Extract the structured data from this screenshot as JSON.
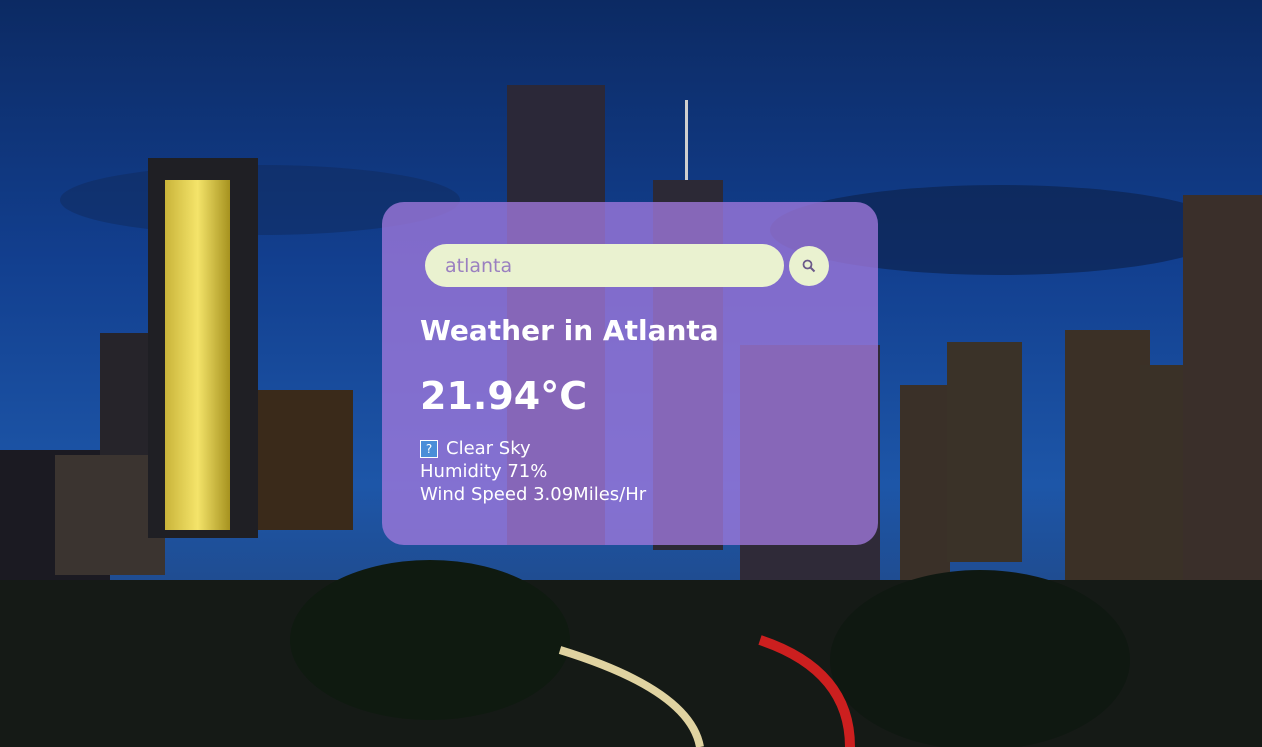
{
  "search": {
    "value": "atlanta",
    "button_icon": "search-icon"
  },
  "weather": {
    "title": "Weather in Atlanta",
    "temperature": "21.94°C",
    "condition_icon": "unknown-image-icon",
    "condition": "Clear Sky",
    "humidity": "Humidity 71%",
    "wind": "Wind Speed 3.09Miles/Hr"
  },
  "colors": {
    "card_bg": "#a078dc",
    "input_bg": "#eaf2d0",
    "input_text": "#9a7fc0",
    "text": "#ffffff"
  },
  "background": {
    "description_icon": "city-skyline-night-photo"
  }
}
